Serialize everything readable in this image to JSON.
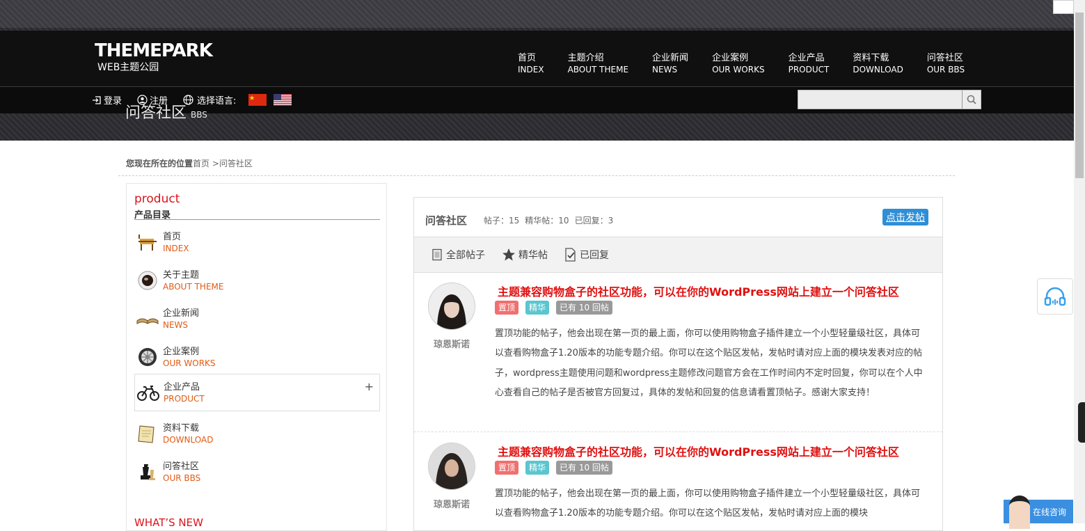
{
  "header": {
    "logo_main": "THEMEPARK",
    "logo_sub": "WEB主题公园",
    "nav": [
      {
        "cn": "首页",
        "en": "INDEX"
      },
      {
        "cn": "主题介绍",
        "en": "ABOUT THEME"
      },
      {
        "cn": "企业新闻",
        "en": "NEWS"
      },
      {
        "cn": "企业案例",
        "en": "OUR WORKS"
      },
      {
        "cn": "企业产品",
        "en": "PRODUCT"
      },
      {
        "cn": "资料下载",
        "en": "DOWNLOAD"
      },
      {
        "cn": "问答社区",
        "en": "OUR BBS"
      }
    ],
    "login": "登录",
    "register": "注册",
    "language_label": "选择语言:",
    "search_placeholder": "",
    "page_title": "问答社区",
    "page_title_en": "BBS"
  },
  "breadcrumb": {
    "prefix": "您现在所在的位置",
    "home": "首页",
    "sep": " >",
    "current": "问答社区"
  },
  "sidebar": {
    "title": "product",
    "subtitle": "产品目录",
    "items": [
      {
        "cn": "首页",
        "en": "INDEX",
        "icon": "chair-icon"
      },
      {
        "cn": "关于主题",
        "en": "ABOUT THEME",
        "icon": "coffee-icon"
      },
      {
        "cn": "企业新闻",
        "en": "NEWS",
        "icon": "book-icon"
      },
      {
        "cn": "企业案例",
        "en": "OUR WORKS",
        "icon": "wheel-icon"
      },
      {
        "cn": "企业产品",
        "en": "PRODUCT",
        "icon": "bicycle-icon"
      },
      {
        "cn": "资料下载",
        "en": "DOWNLOAD",
        "icon": "notepad-icon"
      },
      {
        "cn": "问答社区",
        "en": "OUR BBS",
        "icon": "chess-icon"
      }
    ],
    "expand": "+",
    "whats_new": "WHAT’S NEW"
  },
  "forum": {
    "title": "问答社区",
    "stats": [
      "帖子：15",
      "精华帖：10",
      "已回复：3"
    ],
    "post_button": "点击发帖",
    "tabs": [
      "全部帖子",
      "精华帖",
      "已回复"
    ],
    "posts": [
      {
        "author": "琼恩斯诺",
        "title": "主题兼容购物盒子的社区功能，可以在你的WordPress网站上建立一个问答社区",
        "tags": [
          "置顶",
          "精华",
          "已有 10 回帖"
        ],
        "body": "置顶功能的帖子，他会出现在第一页的最上面，你可以使用购物盒子插件建立一个小型轻量级社区，具体可以查看购物盒子1.20版本的功能专题介绍。你可以在这个贴区发帖，发帖时请对应上面的模块发表对应的帖子，wordpress主题使用问题和wordpress主题修改问题官方会在工作时间内不定时回复，你可以在个人中心查看自己的帖子是否被官方回复过，具体的发帖和回复的信息请看置顶帖子。感谢大家支持！"
      },
      {
        "author": "琼恩斯诺",
        "title": "主题兼容购物盒子的社区功能，可以在你的WordPress网站上建立一个问答社区",
        "tags": [
          "置顶",
          "精华",
          "已有 10 回帖"
        ],
        "body": "置顶功能的帖子，他会出现在第一页的最上面，你可以使用购物盒子插件建立一个小型轻量级社区，具体可以查看购物盒子1.20版本的功能专题介绍。你可以在这个贴区发帖，发帖时请对应上面的模块"
      }
    ]
  },
  "float": {
    "consult": "在线咨询"
  },
  "colors": {
    "accent_red": "#e01010",
    "button_blue": "#2f8ed6",
    "tag_top": "#f07070",
    "tag_essence": "#5ac6cf",
    "tag_reply": "#999999",
    "sub_orange": "#e05a14"
  }
}
